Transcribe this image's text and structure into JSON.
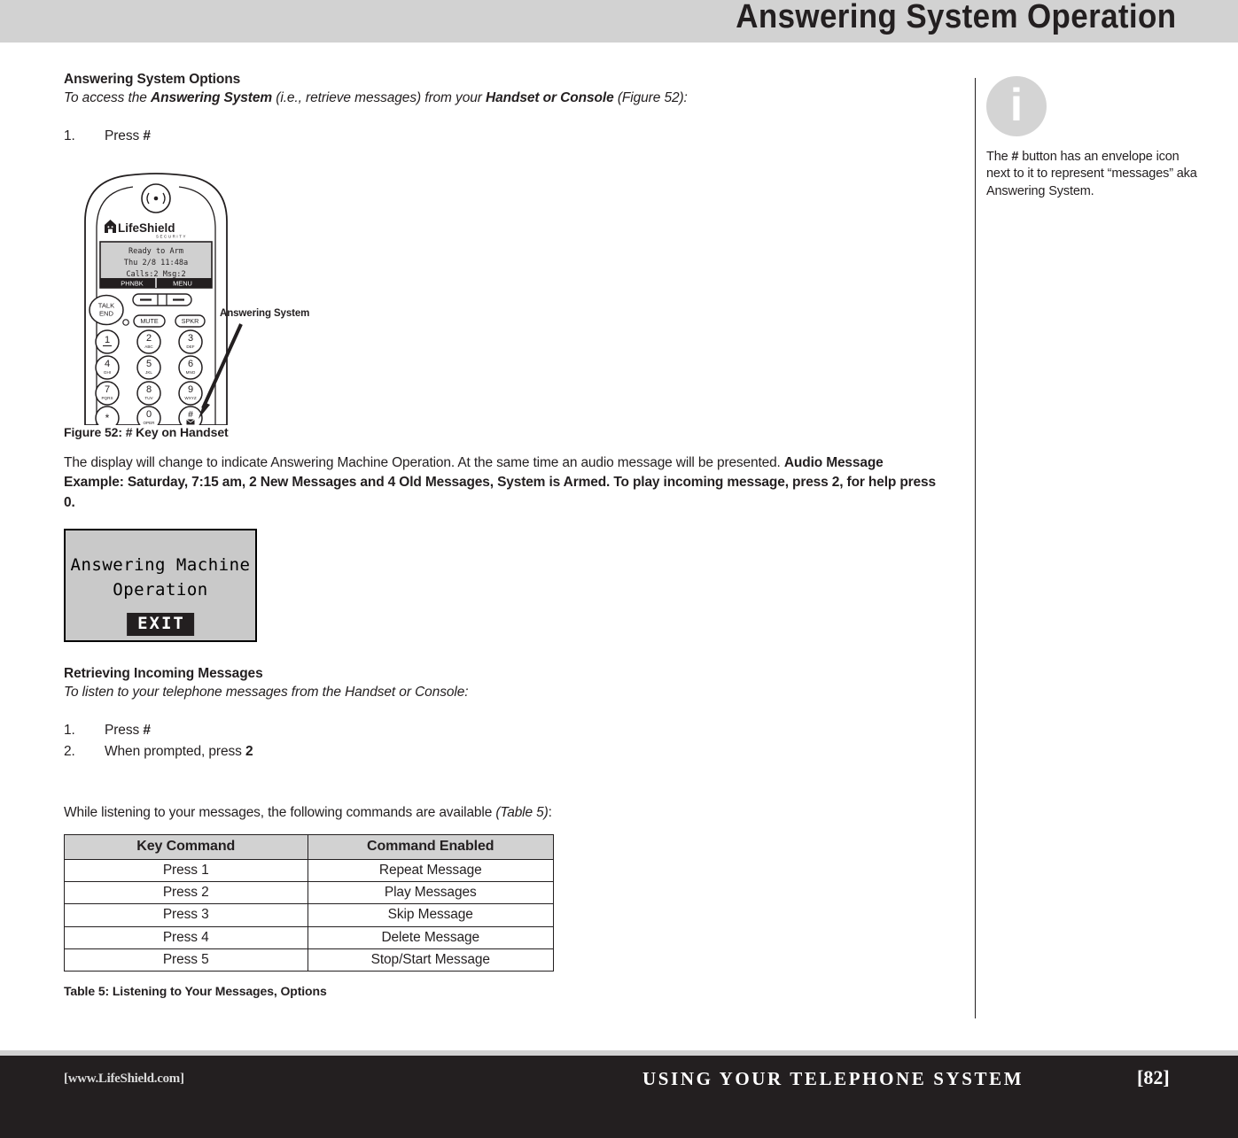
{
  "header": {
    "title": "Answering System Operation"
  },
  "main": {
    "section1": {
      "heading": "Answering System Options",
      "subheading_parts": [
        {
          "text": "To access the ",
          "bold": false
        },
        {
          "text": "Answering System",
          "bold": true
        },
        {
          "text": " (i.e., retrieve messages) from your ",
          "bold": false
        },
        {
          "text": "Handset or Console",
          "bold": true
        },
        {
          "text": " (Figure 52):",
          "bold": false
        }
      ],
      "steps": [
        {
          "num": "1.",
          "text": "Press ",
          "bold_suffix": "#"
        }
      ]
    },
    "figure": {
      "caption": "Figure 52: # Key on Handset",
      "callout_label": "Answering System",
      "handset": {
        "brand": "LifeShield",
        "brand_sub": "SECURITY",
        "lcd_lines": [
          "Ready to Arm",
          "Thu 2/8 11:48a",
          "Calls:2  Msg:2"
        ],
        "softkey_left": "PHNBK",
        "softkey_right": "MENU",
        "talk_line1": "TALK",
        "talk_line2": "END",
        "mute_label": "MUTE",
        "spkr_label": "SPKR",
        "keys": [
          {
            "digit": "1",
            "letters": ""
          },
          {
            "digit": "2",
            "letters": "ABC"
          },
          {
            "digit": "3",
            "letters": "DEF"
          },
          {
            "digit": "4",
            "letters": "GHI"
          },
          {
            "digit": "5",
            "letters": "JKL"
          },
          {
            "digit": "6",
            "letters": "MNO"
          },
          {
            "digit": "7",
            "letters": "PQRS"
          },
          {
            "digit": "8",
            "letters": "TUV"
          },
          {
            "digit": "9",
            "letters": "WXYZ"
          },
          {
            "digit": "*",
            "letters": ""
          },
          {
            "digit": "0",
            "letters": "OPER"
          },
          {
            "digit": "#",
            "letters": ""
          }
        ]
      }
    },
    "para1": "The display will change to indicate Answering Machine Operation. At the same time an audio message will be presented.",
    "para1_bold": "Audio Message Example: Saturday, 7:15 am, 2 New Messages and 4 Old Messages, System is Armed. To play incoming message, press 2, for help press 0.",
    "lcd_screen": {
      "line1": "Answering Machine",
      "line2": "Operation",
      "exit_label": "EXIT"
    },
    "section2": {
      "heading": "Retrieving Incoming Messages",
      "subheading": "To listen to your telephone messages from the Handset or Console:",
      "steps": [
        {
          "num": "1.",
          "text": "Press ",
          "bold_suffix": "#"
        },
        {
          "num": "2.",
          "text": "When prompted, press ",
          "bold_suffix": "2"
        }
      ]
    },
    "table_intro": "While listening to your messages, the following commands are available ",
    "table_intro_italic": "(Table 5)",
    "table_intro_tail": ":",
    "table": {
      "headers": [
        "Key Command",
        "Command Enabled"
      ],
      "rows": [
        [
          "Press 1",
          "Repeat Message"
        ],
        [
          "Press 2",
          "Play Messages"
        ],
        [
          "Press 3",
          "Skip Message"
        ],
        [
          "Press 4",
          "Delete Message"
        ],
        [
          "Press 5",
          "Stop/Start Message"
        ]
      ],
      "caption": "Table 5: Listening to Your Messages, Options"
    }
  },
  "sidebar": {
    "icon": "info-icon",
    "icon_glyph": "i",
    "note_parts": [
      {
        "text": "The ",
        "bold": false
      },
      {
        "text": "#",
        "bold": true
      },
      {
        "text": " button has an envelope icon next to it to represent “messages” aka Answering System.",
        "bold": false
      }
    ]
  },
  "footer": {
    "url": "[www.LifeShield.com]",
    "section": "USING YOUR TELEPHONE SYSTEM",
    "page": "[82]"
  },
  "colors": {
    "header_band": "#d2d2d2",
    "footer_band": "#231f20",
    "ink": "#231f20",
    "lcd_bg": "#c9c9c9",
    "info_circle": "#d4d4d4"
  }
}
